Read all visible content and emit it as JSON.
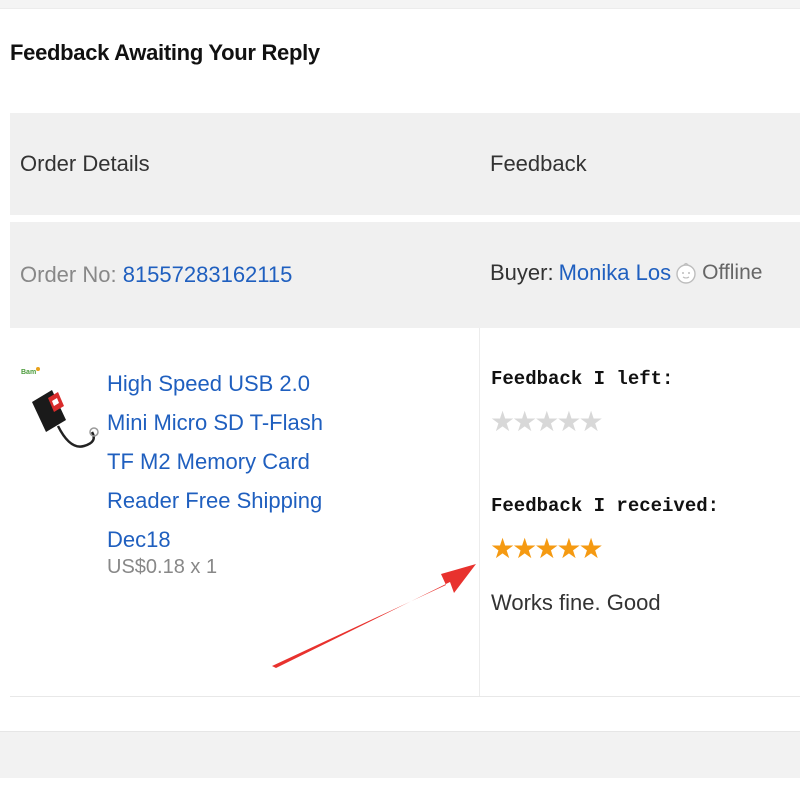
{
  "section": {
    "title": "Feedback Awaiting Your Reply"
  },
  "table": {
    "header": {
      "order_details": "Order Details",
      "feedback": "Feedback"
    },
    "order": {
      "order_no_label": "Order No: ",
      "order_no": "81557283162115",
      "buyer_label": "Buyer:",
      "buyer_name": "Monika Los",
      "buyer_status": "Offline",
      "status_icon": "chat-face-icon"
    },
    "product": {
      "thumbnail_icon": "usb-card-reader-image",
      "title": "High Speed USB 2.0 Mini Micro SD T-Flash TF M2 Memory Card Reader Free Shipping Dec18",
      "price": "US$0.18 x 1"
    },
    "feedback": {
      "left_label": "Feedback I left:",
      "left_rating": 0,
      "received_label": "Feedback I received:",
      "received_rating": 5,
      "received_comment": "Works fine. Good",
      "max_rating": 5
    }
  },
  "colors": {
    "link": "#1f5fbf",
    "star_filled": "#f59a12",
    "star_empty": "#d8d8d8",
    "annotation_arrow": "#e8322e",
    "row_background": "#f0f0f0"
  },
  "annotation": {
    "arrow_icon": "red-arrow-annotation"
  }
}
